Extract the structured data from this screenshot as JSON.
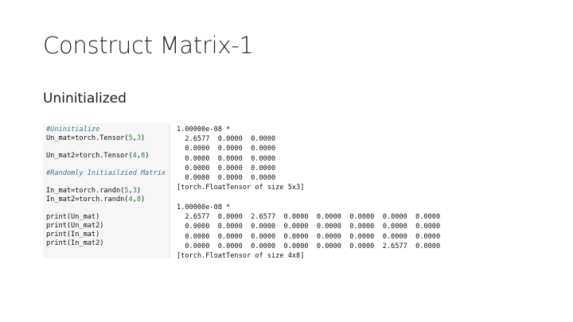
{
  "slide": {
    "title": "Construct Matrix-1",
    "subtitle": "Uninitialized"
  },
  "code": {
    "lines": [
      {
        "kind": "comment",
        "text": "#Uninitialize"
      },
      {
        "kind": "code",
        "pre": "Un_mat=torch.Tensor(",
        "num1": "5",
        "sep": ",",
        "num2": "3",
        "post": ")"
      },
      {
        "kind": "blank"
      },
      {
        "kind": "code",
        "pre": "Un_mat2=torch.Tensor(",
        "num1": "4",
        "sep": ",",
        "num2": "8",
        "post": ")"
      },
      {
        "kind": "blank"
      },
      {
        "kind": "comment",
        "text": "#Randomly Initiailzied Matrix"
      },
      {
        "kind": "blank"
      },
      {
        "kind": "code",
        "pre": "In_mat=torch.randn(",
        "num1": "5",
        "sep": ",",
        "num2": "3",
        "post": ")"
      },
      {
        "kind": "code",
        "pre": "In_mat2=torch.randn(",
        "num1": "4",
        "sep": ",",
        "num2": "8",
        "post": ")"
      },
      {
        "kind": "blank"
      },
      {
        "kind": "text",
        "text": "print(Un_mat)"
      },
      {
        "kind": "text",
        "text": "print(Un_mat2)"
      },
      {
        "kind": "text",
        "text": "print(In_mat)"
      },
      {
        "kind": "text",
        "text": "print(In_mat2)"
      }
    ]
  },
  "output": {
    "block1": [
      "1.00000e-08 *",
      "  2.6577  0.0000  0.0000",
      "  0.0000  0.0000  0.0000",
      "  0.0000  0.0000  0.0000",
      "  0.0000  0.0000  0.0000",
      "  0.0000  0.0000  0.0000",
      "[torch.FloatTensor of size 5x3]"
    ],
    "block2": [
      "1.00000e-08 *",
      "  2.6577  0.0000  2.6577  0.0000  0.0000  0.0000  0.0000  0.0000",
      "  0.0000  0.0000  0.0000  0.0000  0.0000  0.0000  0.0000  0.0000",
      "  0.0000  0.0000  0.0000  0.0000  0.0000  0.0000  0.0000  0.0000",
      "  0.0000  0.0000  0.0000  0.0000  0.0000  0.0000  2.6577  0.0000",
      "[torch.FloatTensor of size 4x8]"
    ]
  }
}
